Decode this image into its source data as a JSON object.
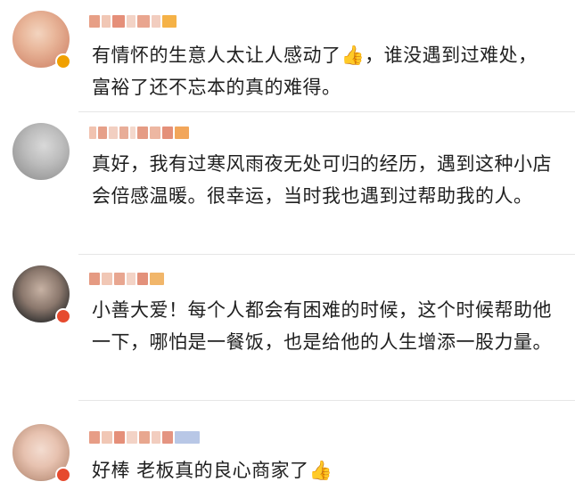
{
  "comments": [
    {
      "text": "有情怀的生意人太让人感动了👍，谁没遇到过难处，富裕了还不忘本的真的难得。",
      "thumb_icon": "👍"
    },
    {
      "text": "真好，我有过寒风雨夜无处可归的经历，遇到这种小店会倍感温暖。很幸运，当时我也遇到过帮助我的人。"
    },
    {
      "text": "小善大爱！每个人都会有困难的时候，这个时候帮助他一下，哪怕是一餐饭，也是给他的人生增添一股力量。"
    },
    {
      "text": "好棒 老板真的良心商家了👍",
      "thumb_icon": "👍"
    }
  ],
  "colors": {
    "divider": "#e6e6e6",
    "vip_badge": "#f0a000",
    "mosaic_name": "#e8a98d"
  }
}
